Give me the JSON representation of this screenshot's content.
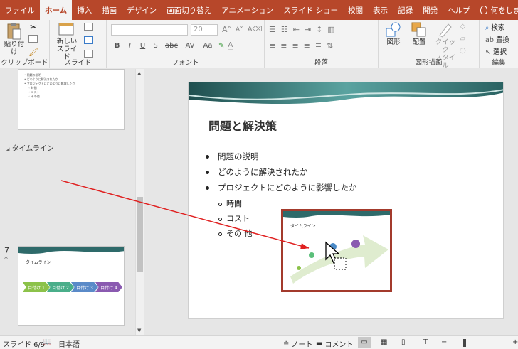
{
  "tabs": [
    "ファイル",
    "ホーム",
    "挿入",
    "描画",
    "デザイン",
    "画面切り替え",
    "アニメーション",
    "スライド ショー",
    "校閲",
    "表示",
    "記録",
    "開発",
    "ヘルプ",
    "何をしますか"
  ],
  "active_tab": "ホーム",
  "ribbon": {
    "clipboard": {
      "label": "クリップボード",
      "paste": "貼り付け"
    },
    "slides": {
      "label": "スライド",
      "new_slide": "新しい\nスライド"
    },
    "font": {
      "label": "フォント",
      "size": "20",
      "buttons": [
        "B",
        "I",
        "U",
        "S",
        "abc",
        "AV",
        "Aa"
      ]
    },
    "paragraph": {
      "label": "段落"
    },
    "drawing": {
      "label": "図形描画",
      "shapes": "図形",
      "arrange": "配置",
      "quick_style": "クイック\nスタイル"
    },
    "editing": {
      "label": "編集",
      "find": "検索",
      "replace": "置換",
      "select": "選択"
    }
  },
  "left_pane": {
    "section_label": "タイムライン",
    "slide7_number": "7",
    "slide7_star": "*",
    "thumb_top_lines": [
      "問題の説明",
      "どのように解決されたか",
      "プロジェクトにどのように影響したか",
      "時間",
      "コスト",
      "その他"
    ],
    "thumb7_title": "タイムライン",
    "thumb7_chips": [
      "目付け 1",
      "目付け 2",
      "目付け 3",
      "目付け 4"
    ]
  },
  "slide": {
    "title": "問題と解決策",
    "bullets": [
      "問題の説明",
      "どのように解決されたか",
      "プロジェクトにどのように影響したか"
    ],
    "sub_bullets": [
      "時間",
      "コスト",
      "その 他"
    ],
    "inset_title": "タイムライン"
  },
  "status": {
    "slide_info": "スライド 6/9",
    "language": "日本語",
    "notes": "ノート",
    "comments": "コメント"
  },
  "colors": {
    "accent": "#b7472a",
    "arrow": "#e02020",
    "frame": "#a33a2c"
  }
}
